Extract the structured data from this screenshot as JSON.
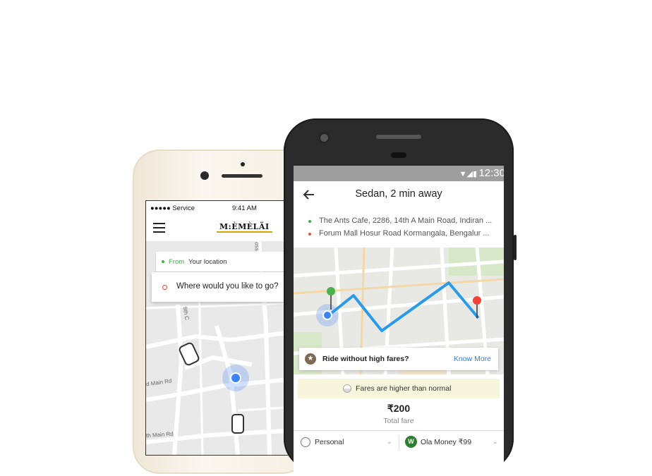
{
  "ios_app": {
    "status": {
      "carrier": "●●●●● Service",
      "time": "9:41 AM"
    },
    "brand": "M:ÈMÈLÄI",
    "from": {
      "label": "From",
      "value": "Your location"
    },
    "destination_placeholder": "Where would you like to go?",
    "map_labels": [
      "9th C",
      "d Main Rd",
      "th Main Rd",
      "oss"
    ]
  },
  "android_app": {
    "status_time": "12:30",
    "title": "Sedan, 2 min away",
    "route": {
      "pickup": "The Ants Cafe, 2286, 14th A Main Road, Indiran ...",
      "drop": "Forum Mall Hosur Road Kormangala, Bengalur ..."
    },
    "promo": {
      "text": "Ride without high fares?",
      "link": "Know More"
    },
    "notice": "Fares are higher than normal",
    "fare": {
      "amount": "₹200",
      "label": "Total fare"
    },
    "payment": {
      "profile": "Personal",
      "method": "Ola Money ₹99"
    }
  },
  "colors": {
    "route": "#2a9be8",
    "pickup": "#3bb24a",
    "drop": "#e84c3d",
    "link": "#2f7fd1",
    "user_dot": "#3b82f6"
  },
  "icons": [
    "hamburger-icon",
    "back-arrow-icon",
    "star-icon",
    "car-icon",
    "location-pin-icon",
    "wallet-icon",
    "chevron-down-icon"
  ]
}
